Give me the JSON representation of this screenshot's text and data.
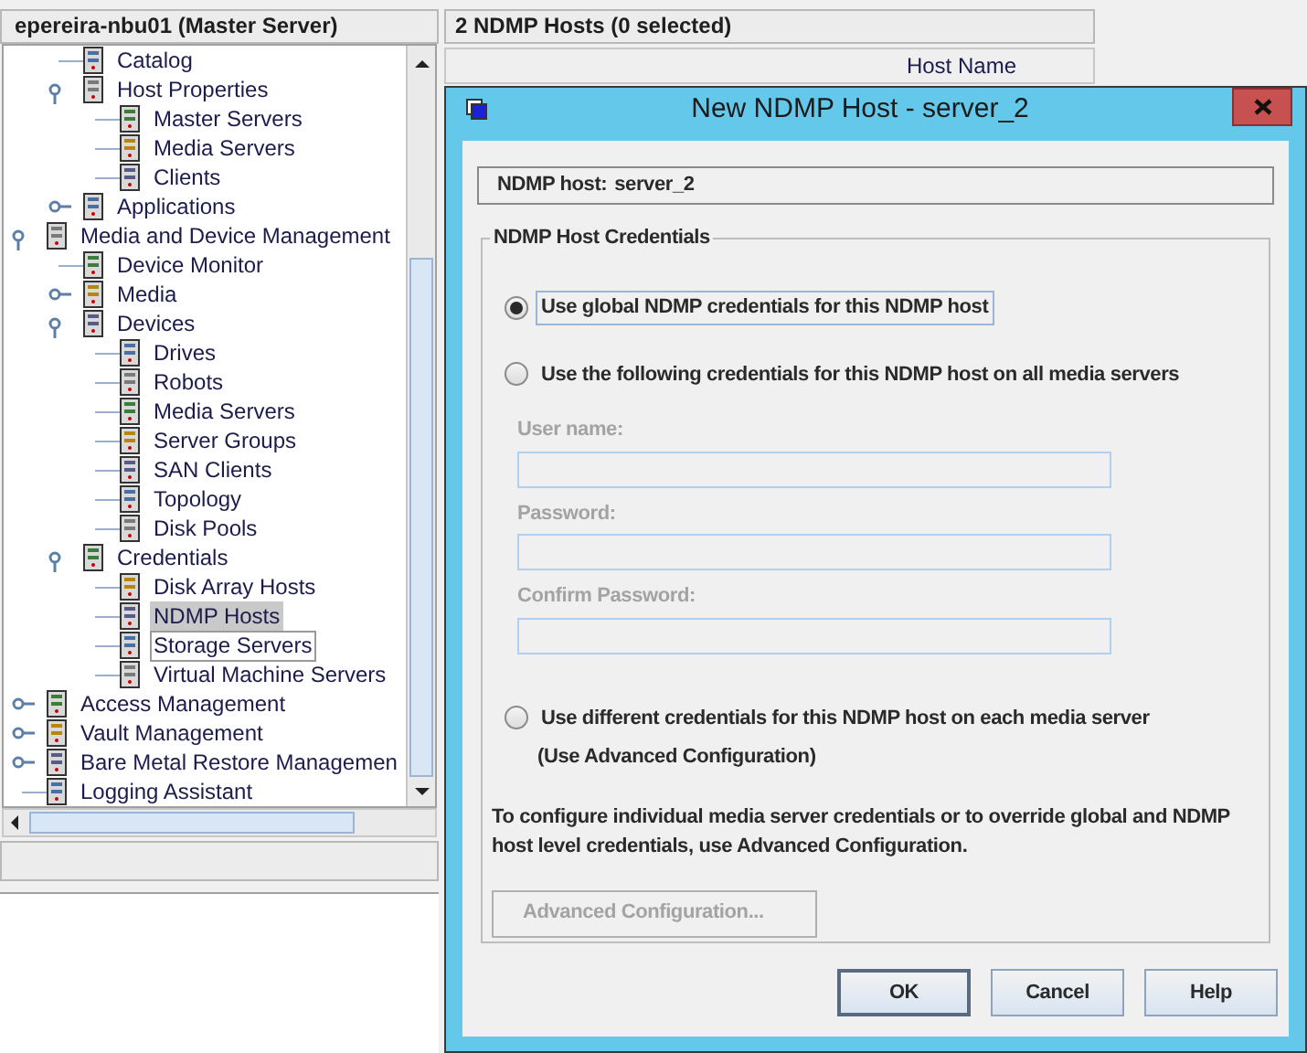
{
  "main_window": {
    "server_title": "epereira-nbu01 (Master Server)",
    "tree": {
      "partial_branch": [
        {
          "label": "Catalog",
          "selected": false,
          "focused": false
        },
        {
          "label": "Host Properties",
          "expanded": true,
          "selected": false,
          "focused": false,
          "children": [
            {
              "label": "Master Servers",
              "selected": false,
              "focused": false
            },
            {
              "label": "Media Servers",
              "selected": false,
              "focused": false
            },
            {
              "label": "Clients",
              "selected": false,
              "focused": false
            }
          ]
        },
        {
          "label": "Applications",
          "expanded": false,
          "selected": false,
          "focused": false
        }
      ],
      "items": [
        {
          "label": "Media and Device Management",
          "expanded": true,
          "selected": false,
          "focused": false,
          "children": [
            {
              "label": "Device Monitor",
              "selected": false,
              "focused": false
            },
            {
              "label": "Media",
              "expanded": false,
              "selected": false,
              "focused": false
            },
            {
              "label": "Devices",
              "expanded": true,
              "selected": false,
              "focused": false,
              "children": [
                {
                  "label": "Drives",
                  "selected": false,
                  "focused": false
                },
                {
                  "label": "Robots",
                  "selected": false,
                  "focused": false
                },
                {
                  "label": "Media Servers",
                  "selected": false,
                  "focused": false
                },
                {
                  "label": "Server Groups",
                  "selected": false,
                  "focused": false
                },
                {
                  "label": "SAN Clients",
                  "selected": false,
                  "focused": false
                },
                {
                  "label": "Topology",
                  "selected": false,
                  "focused": false
                },
                {
                  "label": "Disk Pools",
                  "selected": false,
                  "focused": false
                }
              ]
            },
            {
              "label": "Credentials",
              "expanded": true,
              "selected": false,
              "focused": false,
              "children": [
                {
                  "label": "Disk Array Hosts",
                  "selected": false,
                  "focused": false
                },
                {
                  "label": "NDMP Hosts",
                  "selected": true,
                  "focused": false
                },
                {
                  "label": "Storage Servers",
                  "selected": false,
                  "focused": true
                },
                {
                  "label": "Virtual Machine Servers",
                  "selected": false,
                  "focused": false
                }
              ]
            }
          ]
        },
        {
          "label": "Access Management",
          "expanded": false,
          "selected": false,
          "focused": false
        },
        {
          "label": "Vault Management",
          "expanded": false,
          "selected": false,
          "focused": false
        },
        {
          "label": "Bare Metal Restore Managemen",
          "expanded": false,
          "selected": false,
          "focused": false
        },
        {
          "label": "Logging Assistant",
          "selected": false,
          "focused": false
        }
      ]
    },
    "list_header": "2 NDMP Hosts (0 selected)",
    "columns": [
      "Host Name"
    ]
  },
  "dialog": {
    "title": "New NDMP Host - server_2",
    "host_label": "NDMP host:",
    "host_value": "server_2",
    "group_title": "NDMP Host Credentials",
    "options": [
      {
        "label": "Use global NDMP credentials for this NDMP host",
        "selected": true,
        "focused": true
      },
      {
        "label": "Use the following credentials for this NDMP host on all media servers",
        "selected": false,
        "focused": false
      },
      {
        "label": "Use different credentials for this NDMP host on each media server",
        "note": "(Use Advanced Configuration)",
        "selected": false,
        "focused": false
      }
    ],
    "fields": [
      {
        "label": "User name:",
        "disabled": true
      },
      {
        "label": "Password:",
        "disabled": true
      },
      {
        "label": "Confirm Password:",
        "disabled": true
      }
    ],
    "info": "To configure individual media server credentials or to override global and NDMP host level credentials, use Advanced Configuration.",
    "advanced_button": {
      "label": "Advanced Configuration...",
      "disabled": true
    },
    "buttons": [
      {
        "label": "OK",
        "default": true
      },
      {
        "label": "Cancel",
        "default": false
      },
      {
        "label": "Help",
        "default": false
      }
    ]
  }
}
